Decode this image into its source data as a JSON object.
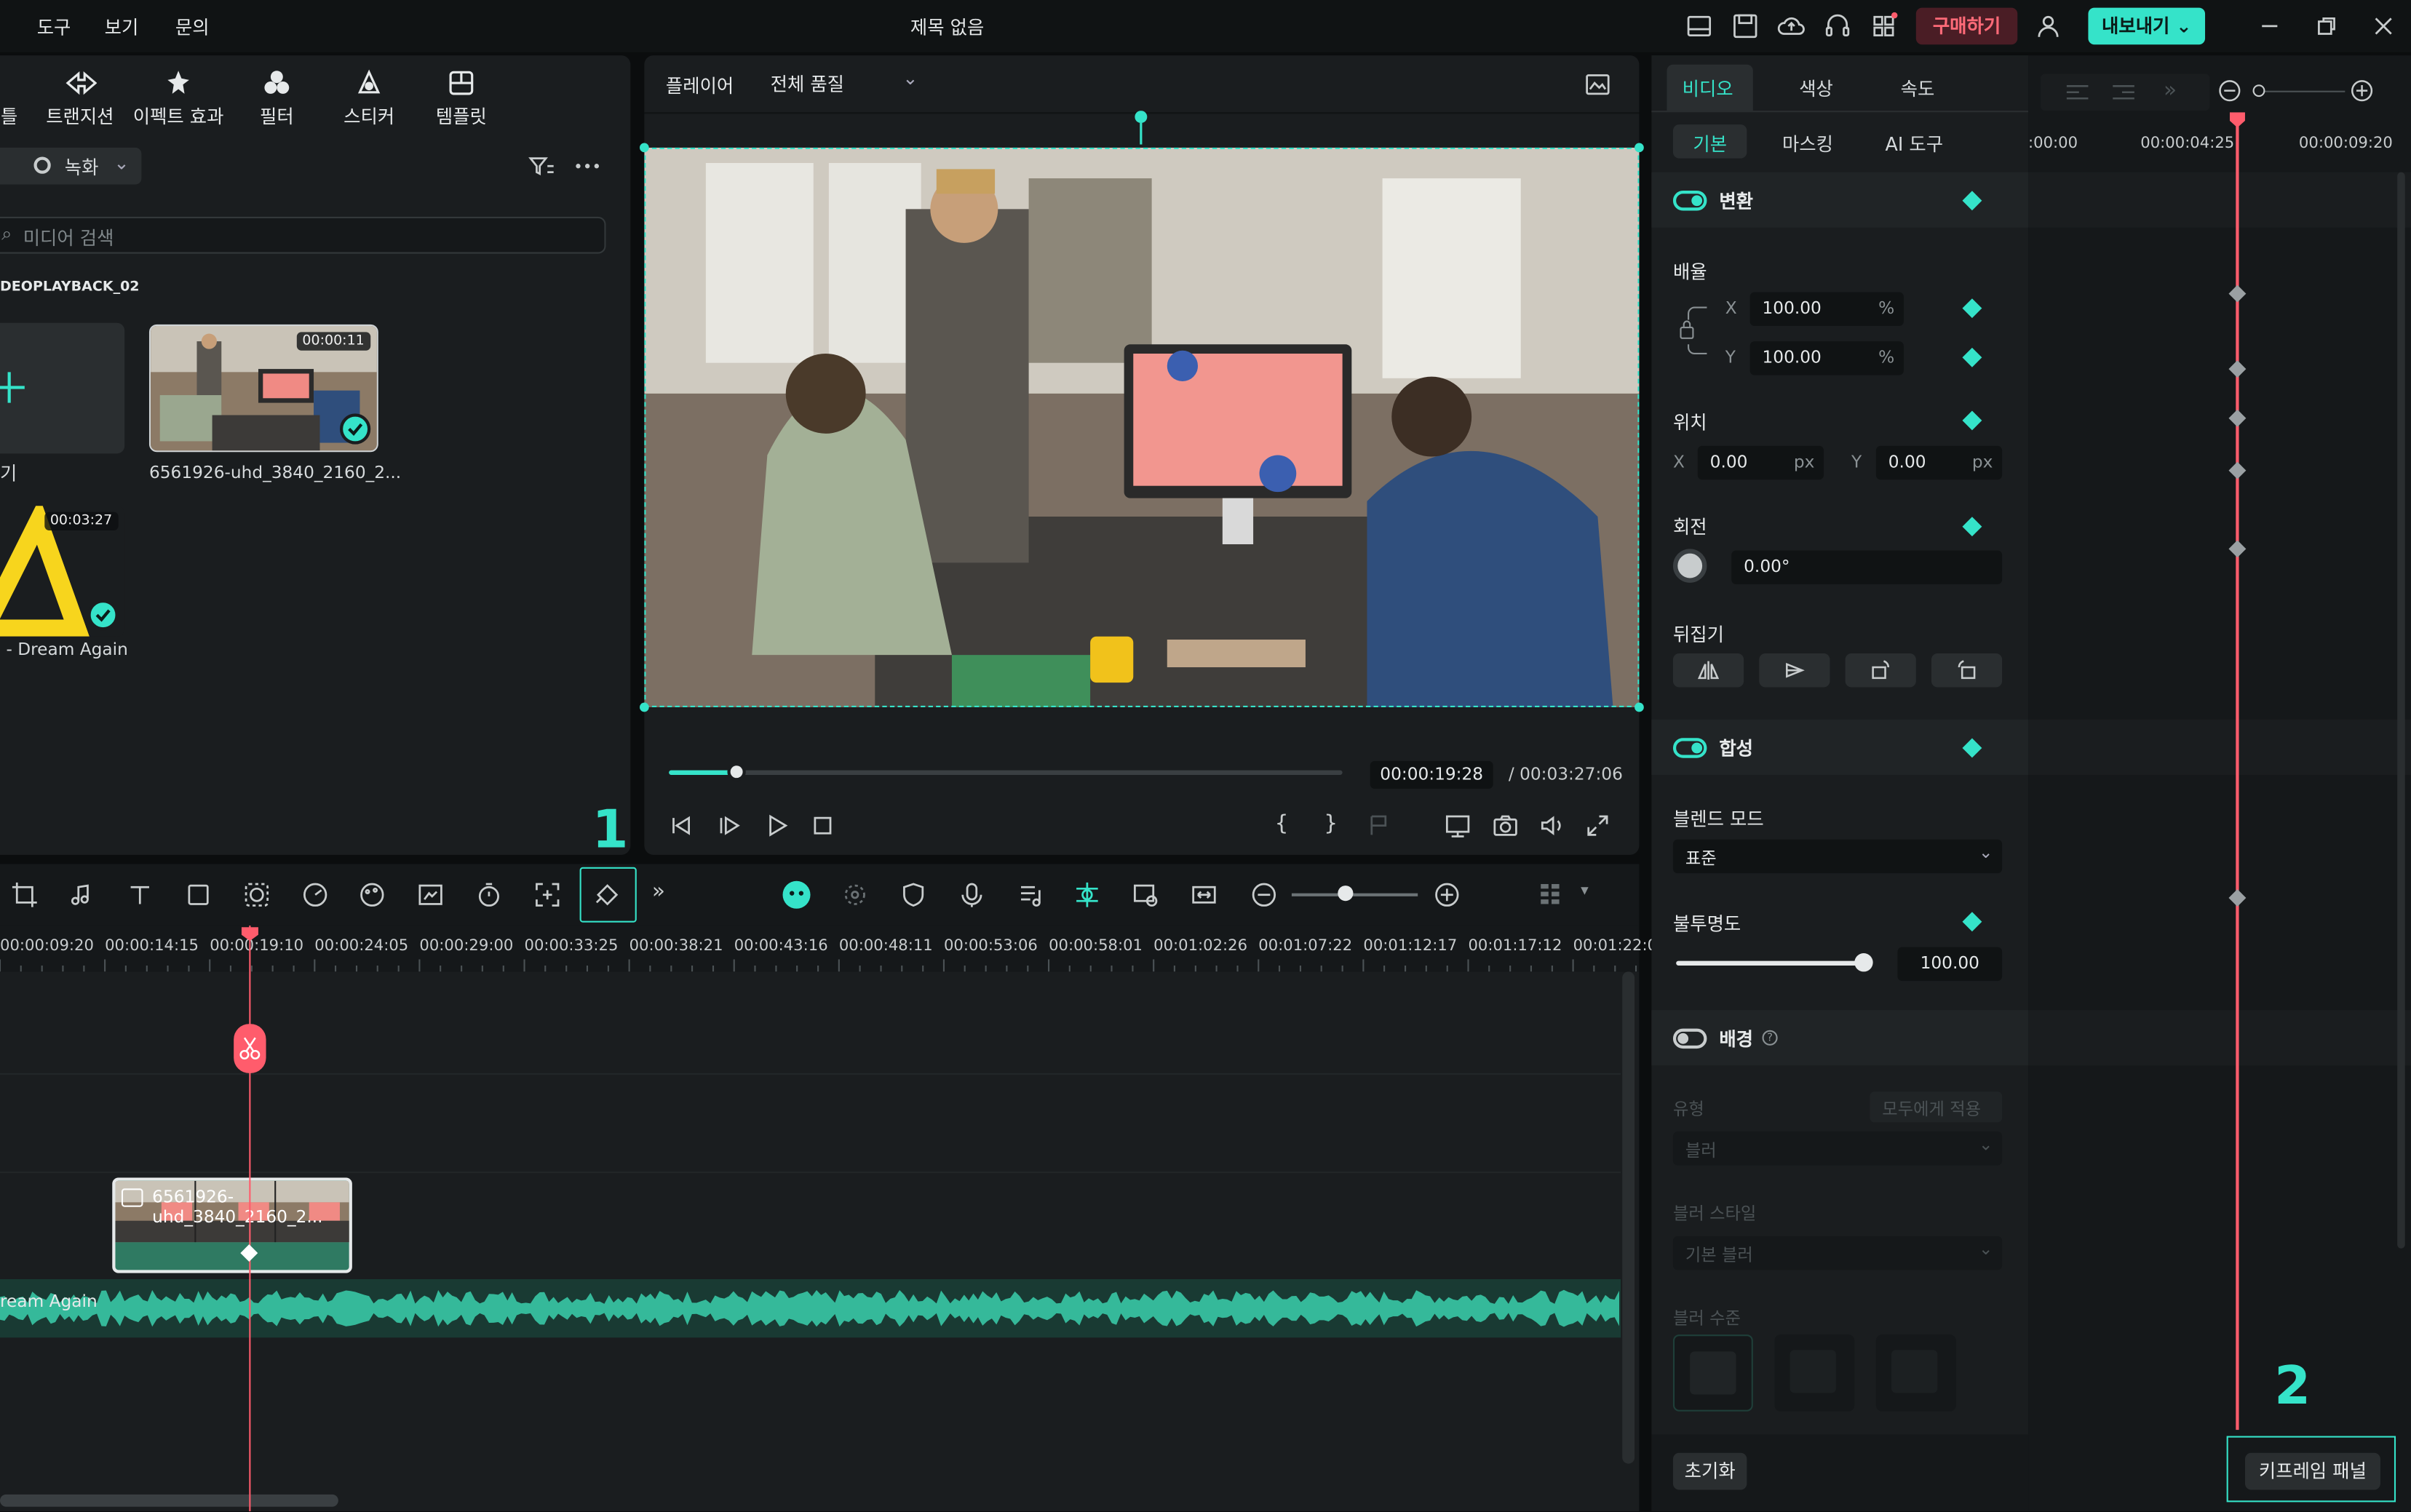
{
  "app": {
    "title": "제목 없음"
  },
  "menu": {
    "tools": "도구",
    "view": "보기",
    "help": "문의"
  },
  "topbar": {
    "buy_label": "구매하기",
    "export_label": "내보내기"
  },
  "media_toolbar": [
    {
      "label": "틀",
      "icon": "text-icon"
    },
    {
      "label": "트랜지션",
      "icon": "transition-icon"
    },
    {
      "label": "이펙트 효과",
      "icon": "effects-icon"
    },
    {
      "label": "필터",
      "icon": "filter-icon"
    },
    {
      "label": "스티커",
      "icon": "sticker-icon"
    },
    {
      "label": "템플릿",
      "icon": "template-icon"
    }
  ],
  "media": {
    "record_label": "녹화",
    "search_placeholder": "미디어 검색",
    "folder_name": "DEOPLAYBACK_02",
    "import_label": "기",
    "items": [
      {
        "name": "6561926-uhd_3840_2160_2...",
        "duration": "00:00:11"
      },
      {
        "name": "- Dream Again",
        "duration": "00:03:27"
      }
    ]
  },
  "player": {
    "label": "플레이어",
    "quality": "전체 품질",
    "current_time": "00:00:19:28",
    "total_time": "00:03:27:06",
    "progress_fraction": 0.1
  },
  "annotations": {
    "step1": "1",
    "step2": "2"
  },
  "timeline": {
    "ruler": [
      "00:00:09:20",
      "00:00:14:15",
      "00:00:19:10",
      "00:00:24:05",
      "00:00:29:00",
      "00:00:33:25",
      "00:00:38:21",
      "00:00:43:16",
      "00:00:48:11",
      "00:00:53:06",
      "00:00:58:01",
      "00:01:02:26",
      "00:01:07:22",
      "00:01:12:17",
      "00:01:17:12",
      "00:01:22:07"
    ],
    "video_clip_name": "6561926-uhd_3840_2160_2...",
    "audio_clip_name": "ream Again"
  },
  "properties": {
    "tabs": [
      "비디오",
      "색상",
      "속도"
    ],
    "subtabs": [
      "기본",
      "마스킹",
      "AI 도구"
    ],
    "transform": {
      "title": "변환",
      "scale_label": "배율",
      "scale_x": "100.00",
      "scale_y": "100.00",
      "percent": "%",
      "x_label": "X",
      "y_label": "Y",
      "position_label": "위치",
      "pos_x": "0.00",
      "pos_y": "0.00",
      "px": "px",
      "rotation_label": "회전",
      "rotation": "0.00°",
      "flip_label": "뒤집기"
    },
    "compositing": {
      "title": "합성",
      "blend_label": "블렌드 모드",
      "blend_value": "표준",
      "opacity_label": "불투명도",
      "opacity": "100.00"
    },
    "background": {
      "title": "배경",
      "type_label": "유형",
      "apply_all": "모두에게 적용",
      "type_value": "블러",
      "style_label": "블러 스타일",
      "style_value": "기본 블러",
      "level_label": "블러 수준"
    },
    "reset_label": "초기화",
    "keyframe_panel_label": "키프레임 패널"
  },
  "keyframe": {
    "ruler": [
      ":00:00",
      "00:00:04:25",
      "00:00:09:20"
    ]
  },
  "colors": {
    "accent": "#35e3c9",
    "playhead": "#ff5c6c",
    "buy": "#ff6a78"
  }
}
